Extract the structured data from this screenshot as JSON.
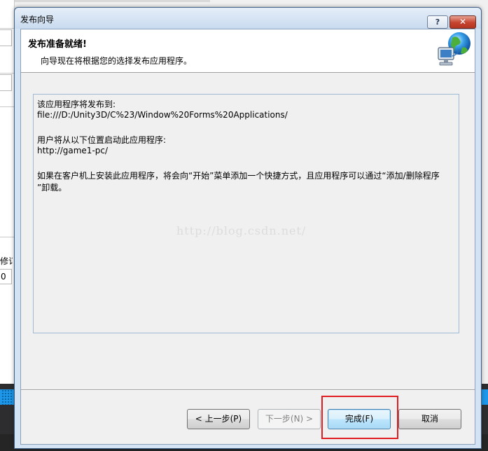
{
  "window": {
    "title": "发布向导",
    "help_label": "?",
    "close_label": "✕"
  },
  "header": {
    "title": "发布准备就绪!",
    "subtitle": "向导现在将根据您的选择发布应用程序。",
    "icon": "network-globe-icon"
  },
  "content": {
    "lines": [
      "该应用程序将发布到:",
      "file:///D:/Unity3D/C%23/Window%20Forms%20Applications/",
      "",
      "用户将从以下位置启动此应用程序:",
      "http://game1-pc/",
      "",
      "如果在客户机上安装此应用程序，将会向“开始”菜单添加一个快捷方式，且应用程序可以通过“添加/删除程序",
      "”卸载。"
    ],
    "watermark": "http://blog.csdn.net/"
  },
  "buttons": {
    "prev": "< 上一步(P)",
    "next": "下一步(N) >",
    "finish": "完成(F)",
    "cancel": "取消"
  },
  "background": {
    "fragment_1": "修订",
    "fragment_2": "0"
  },
  "colors": {
    "highlight": "#e11d22",
    "accent_blue": "#1c97ea"
  }
}
